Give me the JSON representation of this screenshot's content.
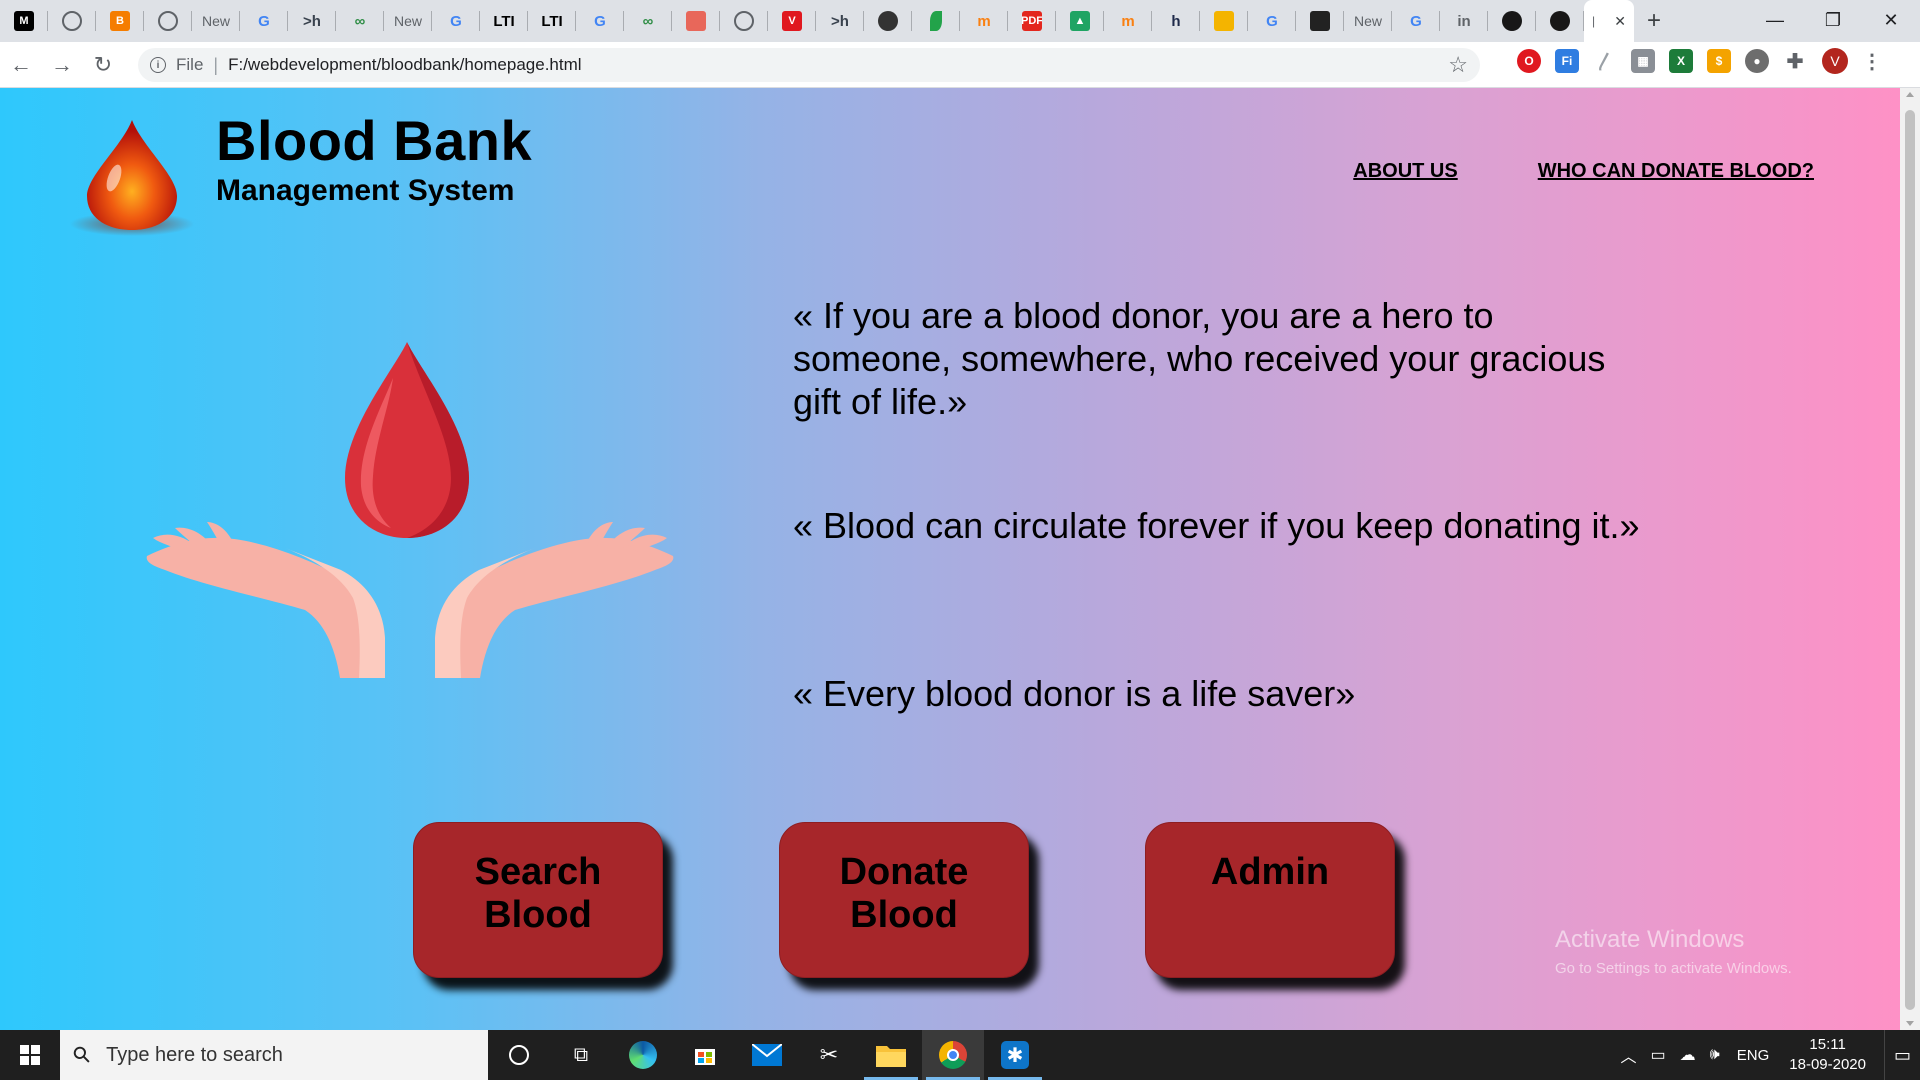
{
  "browser": {
    "tabs": [
      {
        "icon": "medium-icon",
        "label": "M",
        "color": "#000000"
      },
      {
        "icon": "globe-icon",
        "label": "",
        "color": "#5f6368"
      },
      {
        "icon": "blogger-icon",
        "label": "B",
        "color": "#f57d00"
      },
      {
        "icon": "globe-icon",
        "label": "",
        "color": "#5f6368"
      },
      {
        "icon": "new-tab-icon",
        "label": "New",
        "color": ""
      },
      {
        "icon": "google-icon",
        "label": "G",
        "color": "#4285f4"
      },
      {
        "icon": "hackerrank-icon",
        "label": ">h",
        "color": "#39424e"
      },
      {
        "icon": "geeksforgeeks-icon",
        "label": "∞",
        "color": "#2f8d46"
      },
      {
        "icon": "new-tab-icon",
        "label": "New",
        "color": ""
      },
      {
        "icon": "google-icon",
        "label": "G",
        "color": "#4285f4"
      },
      {
        "icon": "lti-icon",
        "label": "LTI",
        "color": "#000000"
      },
      {
        "icon": "lti-icon",
        "label": "LTI",
        "color": "#000000"
      },
      {
        "icon": "google-icon",
        "label": "G",
        "color": "#4285f4"
      },
      {
        "icon": "geeksforgeeks-icon",
        "label": "∞",
        "color": "#2f8d46"
      },
      {
        "icon": "book-icon",
        "label": "",
        "color": "#e8675a"
      },
      {
        "icon": "globe-icon",
        "label": "",
        "color": "#5f6368"
      },
      {
        "icon": "v-icon",
        "label": "V",
        "color": "#e0181f"
      },
      {
        "icon": "hackerrank-icon",
        "label": ">h",
        "color": "#39424e"
      },
      {
        "icon": "circle-icon",
        "label": "",
        "color": "#333333"
      },
      {
        "icon": "leaf-icon",
        "label": "",
        "color": "#22a34a"
      },
      {
        "icon": "moodle-icon",
        "label": "m",
        "color": "#f98012"
      },
      {
        "icon": "pdf-icon",
        "label": "PDF",
        "color": "#e3261d"
      },
      {
        "icon": "drive-icon",
        "label": "▲",
        "color": "#1fa463"
      },
      {
        "icon": "moodle-icon",
        "label": "m",
        "color": "#f98012"
      },
      {
        "icon": "hashnode-icon",
        "label": "h",
        "color": "#1e2a4a"
      },
      {
        "icon": "puzzle-icon",
        "label": "",
        "color": "#f4b400"
      },
      {
        "icon": "google-icon",
        "label": "G",
        "color": "#4285f4"
      },
      {
        "icon": "quill-icon",
        "label": "",
        "color": "#222222"
      },
      {
        "icon": "new-tab-icon",
        "label": "New",
        "color": ""
      },
      {
        "icon": "google-icon",
        "label": "G",
        "color": "#4285f4"
      },
      {
        "icon": "linkedin-icon",
        "label": "in",
        "color": "#5f6368"
      },
      {
        "icon": "github-icon",
        "label": "",
        "color": "#181717"
      },
      {
        "icon": "github-icon",
        "label": "",
        "color": "#181717"
      }
    ],
    "active_tab_close": "✕",
    "new_tab_label": "+",
    "window_controls": {
      "minimize": "—",
      "restore": "❐",
      "close": "✕"
    },
    "url_scheme": "File",
    "url": "F:/webdevelopment/bloodbank/homepage.html",
    "avatar_letter": "V"
  },
  "page": {
    "brand": {
      "title": "Blood Bank",
      "subtitle": "Management System"
    },
    "nav": {
      "about": "ABOUT US",
      "who_can_donate": "WHO CAN DONATE BLOOD?"
    },
    "quotes": [
      "« If you are a blood donor, you are a hero to someone, somewhere, who received your gracious gift of life.»",
      "« Blood can circulate forever if you keep donating it.»",
      "« Every blood donor is a life saver»"
    ],
    "buttons": {
      "search": "Search Blood",
      "donate": "Donate Blood",
      "admin": "Admin"
    },
    "watermark": {
      "title": "Activate Windows",
      "subtitle": "Go to Settings to activate Windows."
    },
    "colors": {
      "button": "#a7262a",
      "gradient_start": "#2ec8fc",
      "gradient_end": "#fe91c6"
    }
  },
  "taskbar": {
    "search_placeholder": "Type here to search",
    "language": "ENG",
    "time": "15:11",
    "date": "18-09-2020"
  }
}
